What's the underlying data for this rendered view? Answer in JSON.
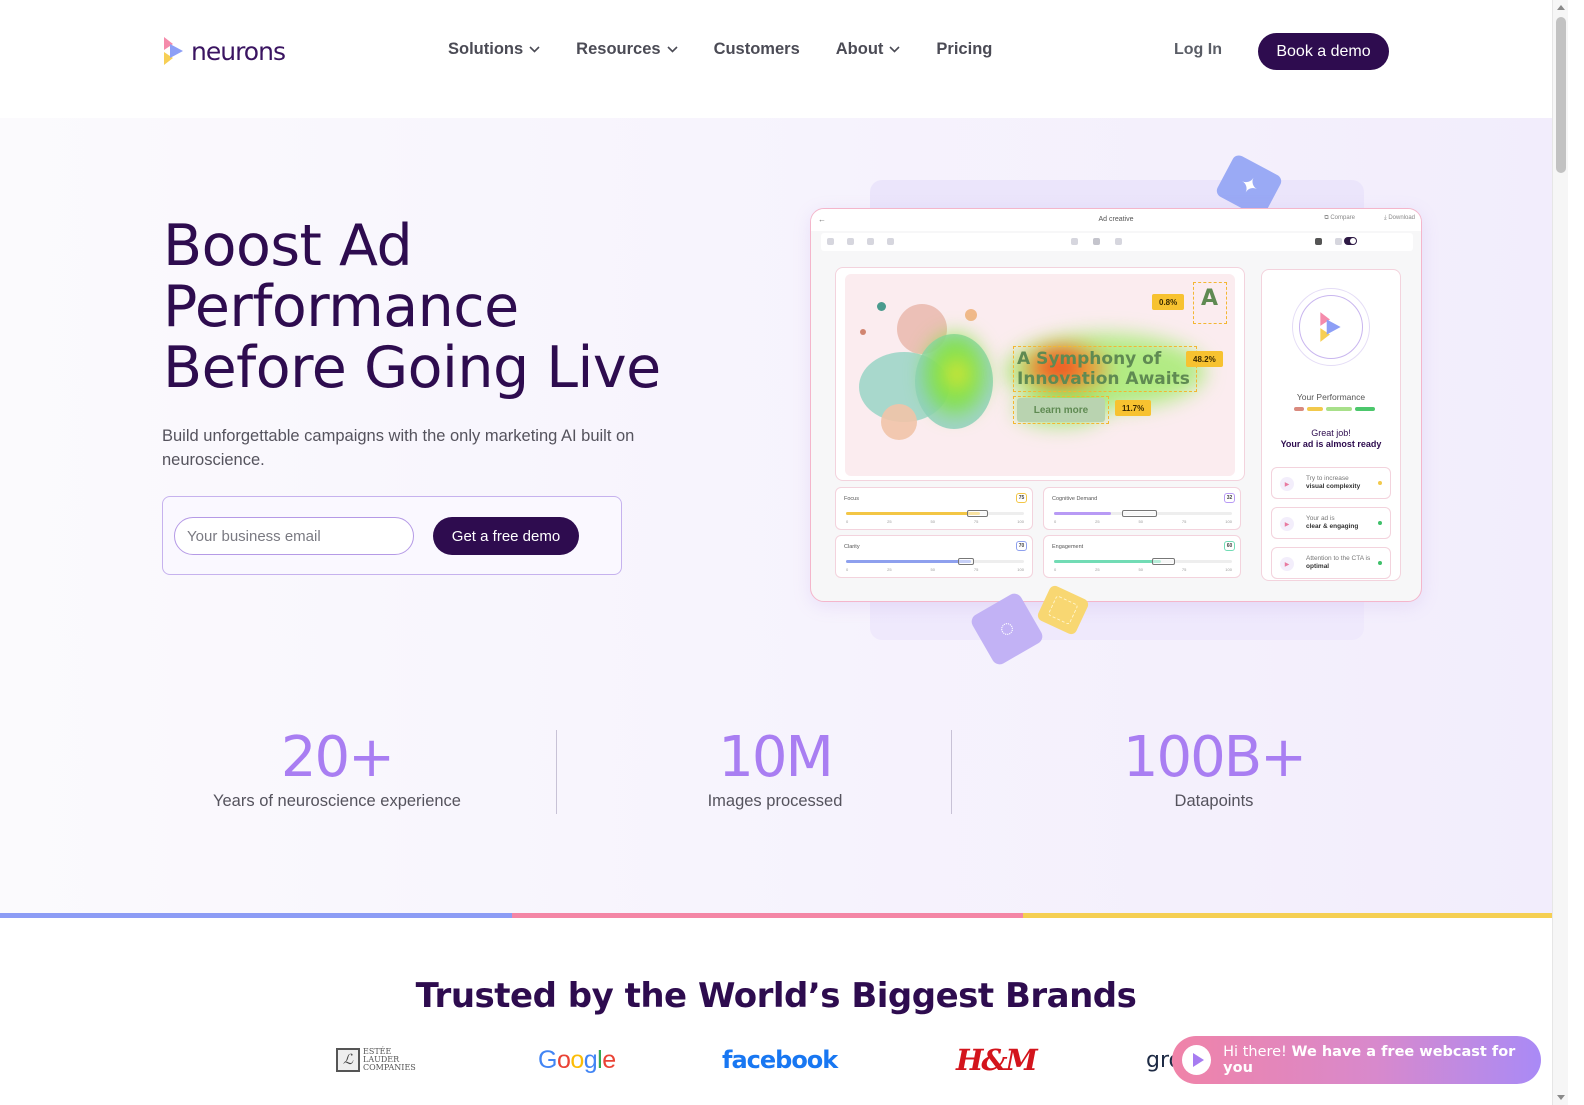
{
  "header": {
    "logo_text": "neurons",
    "nav": [
      {
        "label": "Solutions",
        "has_dropdown": true
      },
      {
        "label": "Resources",
        "has_dropdown": true
      },
      {
        "label": "Customers",
        "has_dropdown": false
      },
      {
        "label": "About",
        "has_dropdown": true
      },
      {
        "label": "Pricing",
        "has_dropdown": false
      }
    ],
    "login_label": "Log In",
    "book_demo_label": "Book a demo"
  },
  "hero": {
    "title": "Boost Ad\nPerformance\nBefore Going Live",
    "subtitle": "Build unforgettable campaigns with the only marketing AI built on neuroscience.",
    "email_placeholder": "Your business email",
    "email_value": "",
    "cta_label": "Get a free demo"
  },
  "mockup": {
    "title": "Ad creative",
    "back_icon": "arrow-left-icon",
    "compare_label": "Compare",
    "download_label": "Download",
    "ad": {
      "headline": "A Symphony of\nInnovation Awaits",
      "button_label": "Learn more",
      "logo_glyph": "A",
      "attention": {
        "logo": "0.8%",
        "headline": "48.2%",
        "cta": "11.7%"
      }
    },
    "metrics": [
      {
        "label": "Focus",
        "value": 75,
        "range": [
          68,
          80
        ],
        "color": "#f3c645",
        "border": "#f3c645"
      },
      {
        "label": "Cognitive Demand",
        "value": 32,
        "range": [
          38,
          58
        ],
        "color": "#b89af5",
        "border": "#b89af5"
      },
      {
        "label": "Clarity",
        "value": 70,
        "range": [
          63,
          72
        ],
        "color": "#8ea0ee",
        "border": "#8ea0ee"
      },
      {
        "label": "Engagement",
        "value": 60,
        "range": [
          55,
          68
        ],
        "color": "#72dcb5",
        "border": "#72dcb5"
      }
    ],
    "metric_ticks": [
      "0",
      "25",
      "50",
      "75",
      "100"
    ],
    "performance": {
      "label": "Your Performance",
      "bar_colors": [
        "#d98a7e",
        "#f2c94c",
        "#a8e08a",
        "#4cc76c"
      ],
      "great": "Great job!",
      "status": "Your ad is almost ready",
      "tips": [
        {
          "pre": "Try to increase",
          "bold": "visual complexity",
          "dot": "#f2c94c"
        },
        {
          "pre": "Your ad is",
          "bold": "clear & engaging",
          "dot": "#3fc06a"
        },
        {
          "pre": "Attention to the CTA is",
          "bold": "optimal",
          "dot": "#3fc06a"
        }
      ]
    }
  },
  "stats": [
    {
      "value": "20+",
      "label": "Years of neuroscience experience"
    },
    {
      "value": "10M",
      "label": "Images processed"
    },
    {
      "value": "100B+",
      "label": "Datapoints"
    }
  ],
  "strip_colors": [
    "#8c9cf5",
    "#f486a6",
    "#f5cf52"
  ],
  "brands": {
    "title": "Trusted by the World’s Biggest Brands",
    "logos": [
      {
        "name": "Estée Lauder Companies",
        "text": "ESTÉE\nLAUDER\nCOMPANIES"
      },
      {
        "name": "Google",
        "text": "Google"
      },
      {
        "name": "facebook",
        "text": "facebook"
      },
      {
        "name": "H&M",
        "text": "H&M"
      },
      {
        "name": "gro (partially hidden)",
        "text": "gro"
      }
    ]
  },
  "chat": {
    "greeting": "Hi there!",
    "message": "We have a free webcast for you"
  },
  "colors": {
    "brand_dark": "#2e0c4f",
    "stat_purple": "#a97ef2",
    "google": [
      "#4285f4",
      "#ea4335",
      "#fbbc05",
      "#4285f4",
      "#34a853",
      "#ea4335"
    ]
  }
}
